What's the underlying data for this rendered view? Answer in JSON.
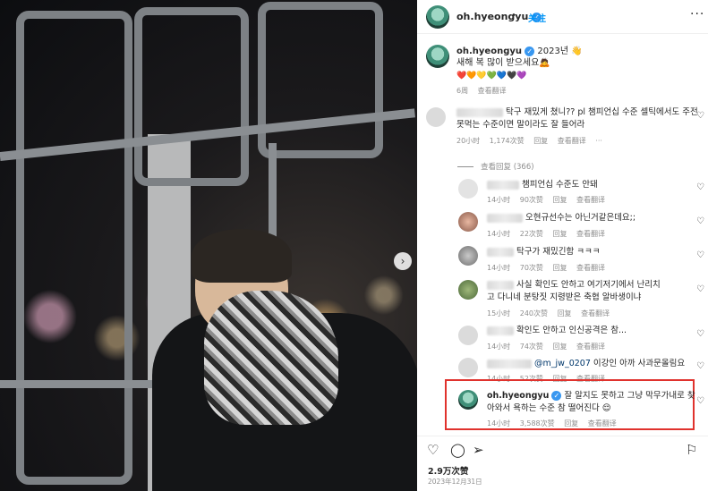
{
  "post": {
    "username": "oh.hyeongyu",
    "follow_label": "关注",
    "more_label": "···",
    "next_label": "›"
  },
  "caption": {
    "username": "oh.hyeongyu",
    "line1": "2023년 👋",
    "line2": "새해 복 많이 받으세요🙇",
    "emojis": "❤️🧡💛💚💙🖤💜",
    "time": "6周",
    "translate": "查看翻译"
  },
  "comments": [
    {
      "text": "탁구 재밌게 쳤니?? pl 챔피언십 수준 셀틱에서도 주전",
      "text2": "못먹는 수준이면 말이라도 잘 들어라",
      "time": "20小时",
      "likes": "1,174次赞",
      "reply": "回复",
      "translate": "查看翻译",
      "more": "···"
    }
  ],
  "view_replies": "查看回复 (366)",
  "replies": [
    {
      "text": "챔피언십 수준도 안돼",
      "time": "14小时",
      "likes": "90次赞",
      "reply": "回复",
      "translate": "查看翻译"
    },
    {
      "text": "오현규선수는 아닌거같은데요;;",
      "time": "14小时",
      "likes": "22次赞",
      "reply": "回复",
      "translate": "查看翻译"
    },
    {
      "text": "탁구가 재밌긴함 ㅋㅋㅋ",
      "time": "14小时",
      "likes": "70次赞",
      "reply": "回复",
      "translate": "查看翻译"
    },
    {
      "text": "사실 확인도 안하고 여기저기에서 난리치",
      "text2": "고 다니네 분탕짓 지령받은 축협 알바생이냐",
      "time": "15小时",
      "likes": "240次赞",
      "reply": "回复",
      "translate": "查看翻译"
    },
    {
      "text": "확인도 안하고 인신공격은 참...",
      "time": "14小时",
      "likes": "74次赞",
      "reply": "回复",
      "translate": "查看翻译"
    },
    {
      "mention": "@m_jw_0207",
      "text": " 이강인 아까 사과문올림요",
      "time": "14小时",
      "likes": "52次赞",
      "reply": "回复",
      "translate": "查看翻译"
    }
  ],
  "highlighted_reply": {
    "username": "oh.hyeongyu",
    "text": "잘 알지도 못하고 그냥 막무가내로 찾",
    "text2": "아와서 욕하는 수준 참 떨어진다 😌",
    "time": "14小时",
    "likes": "3,588次赞",
    "reply": "回复",
    "translate": "查看翻译"
  },
  "footer": {
    "likes": "2.9万次赞",
    "date": "2023年12月31日"
  },
  "colors": {
    "link_blue": "#0095f6",
    "highlight_red": "#e0322d",
    "muted": "#8e8e8e"
  }
}
